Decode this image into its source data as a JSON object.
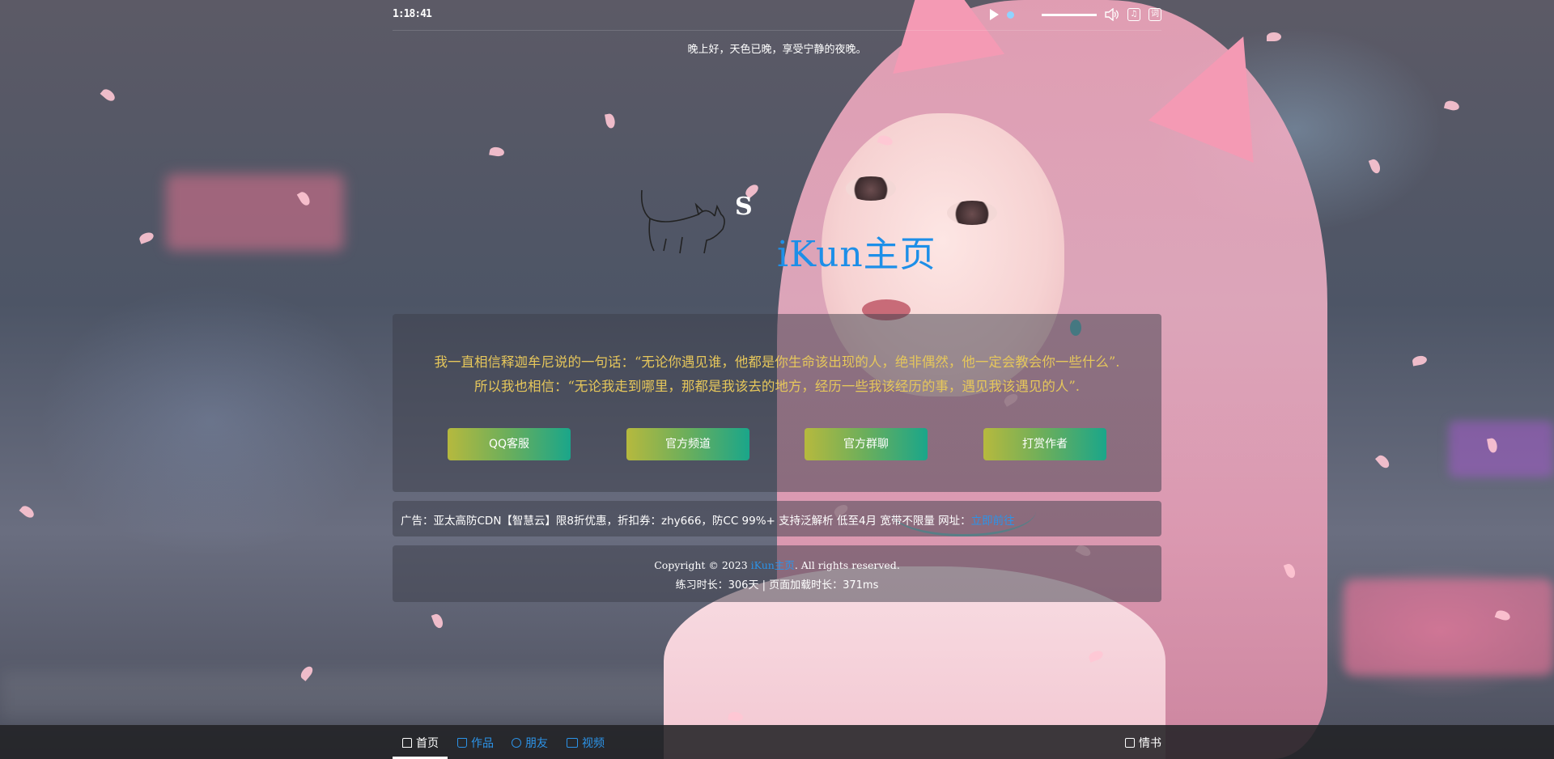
{
  "header": {
    "clock": "1:18:41",
    "greeting": "晚上好，天色已晚，享受宁静的夜晚。",
    "lyrics_icon_char": "词"
  },
  "hero": {
    "title": "iKun主页"
  },
  "quote": {
    "line1": "我一直相信释迦牟尼说的一句话：“无论你遇见谁，他都是你生命该出现的人，绝非偶然，他一定会教会你一些什么”.",
    "line2": "所以我也相信：“无论我走到哪里，那都是我该去的地方，经历一些我该经历的事，遇见我该遇见的人”."
  },
  "buttons": [
    {
      "label": "QQ客服"
    },
    {
      "label": "官方频道"
    },
    {
      "label": "官方群聊"
    },
    {
      "label": "打赏作者"
    }
  ],
  "ad": {
    "text": "广告：亚太高防CDN【智慧云】限8折优惠，折扣券：zhy666，防CC 99%+ 支持泛解析 低至4月 宽带不限量  网址：",
    "link_label": "立即前往"
  },
  "footer": {
    "copyright_prefix": "Copyright © 2023 ",
    "site_name": "iKun主页",
    "copyright_suffix": ". All rights reserved.",
    "stats": "练习时长：306天 | 页面加载时长：371ms"
  },
  "nav": {
    "items": [
      {
        "label": "首页",
        "icon": "home-icon"
      },
      {
        "label": "作品",
        "icon": "bag-icon"
      },
      {
        "label": "朋友",
        "icon": "link-icon"
      },
      {
        "label": "视频",
        "icon": "video-icon"
      }
    ],
    "right_label": "情书",
    "right_icon": "thumb-icon"
  },
  "colors": {
    "accent_blue": "#2c93e8",
    "quote_gold": "#e6c75b",
    "button_gradient_start": "#b6b93e",
    "button_gradient_end": "#1aa68a"
  }
}
